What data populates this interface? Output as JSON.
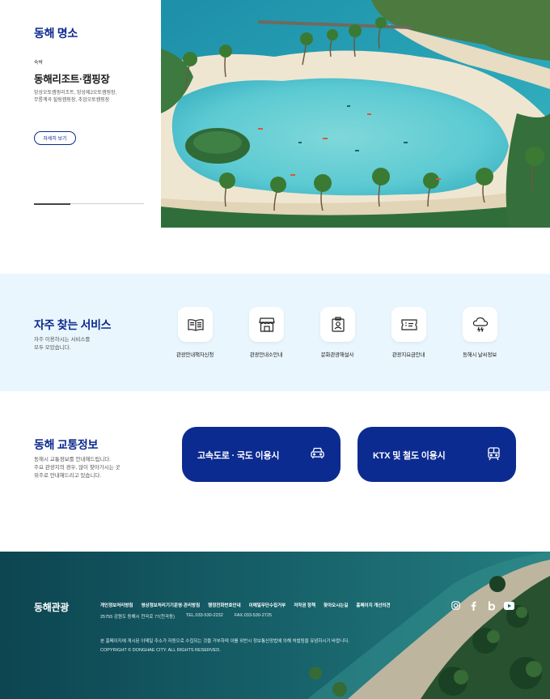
{
  "attractions": {
    "title": "동해 명소",
    "category": "숙박",
    "place_name": "동해리조트·캠핑장",
    "description_lines": [
      "망상오토캠핑리조트, 망상제2오토캠핑장,",
      "무릉계곡 힐링캠핑장, 추암오토캠핑장"
    ],
    "detail_button": "자세히 보기",
    "slide_progress": 0.33
  },
  "services": {
    "title": "자주 찾는 서비스",
    "description_lines": [
      "자주 이용하시는 서비스를",
      "모두 모았습니다."
    ],
    "items": [
      {
        "label": "관광안내책자신청",
        "icon": "book-icon"
      },
      {
        "label": "관광안내소안내",
        "icon": "store-icon"
      },
      {
        "label": "문화관광해설사",
        "icon": "guide-badge-icon"
      },
      {
        "label": "관광지요금안내",
        "icon": "ticket-icon"
      },
      {
        "label": "동해시 날씨정보",
        "icon": "weather-icon"
      }
    ]
  },
  "transport": {
    "title": "동해 교통정보",
    "description_lines": [
      "동해시 교통정보를 안내해드립니다.",
      "주요 관광지의 경우, 많이 찾아가시는 곳",
      "위주로 안내해드리고 있습니다."
    ],
    "buttons": [
      {
        "label": "고속도로 · 국도 이용시",
        "icon": "car-icon"
      },
      {
        "label": "KTX 및 철도 이용시",
        "icon": "train-icon"
      }
    ]
  },
  "footer": {
    "logo": "동해관광",
    "links": [
      "개인정보처리방침",
      "영상정보처리기기운영·관리방침",
      "행정전화번호안내",
      "이메일무단수집거부",
      "저작권 정책",
      "찾아오시는길",
      "홈페이지 개선의견"
    ],
    "address": "25755 강원도 동해시 천곡로 77(천곡동)",
    "tel": "TEL.033-530-2232",
    "fax": "FAX.033-530-2725",
    "notice": "본 홈페이지에 게시된 이메일 주소가 자동으로 수집되는 것을 거부하며 이를 위반시 정보통신망법에 의해 처벌됨을 유념하시기 바랍니다.",
    "copyright": "COPYRIGHT © DONGHAE CITY. ALL RIGHTS RESERVED.",
    "sns": [
      "instagram-icon",
      "facebook-icon",
      "blog-icon",
      "youtube-icon"
    ]
  },
  "colors": {
    "brand": "#0d2a8f",
    "button": "#0c2b91",
    "services_bg": "#e9f6fd"
  }
}
